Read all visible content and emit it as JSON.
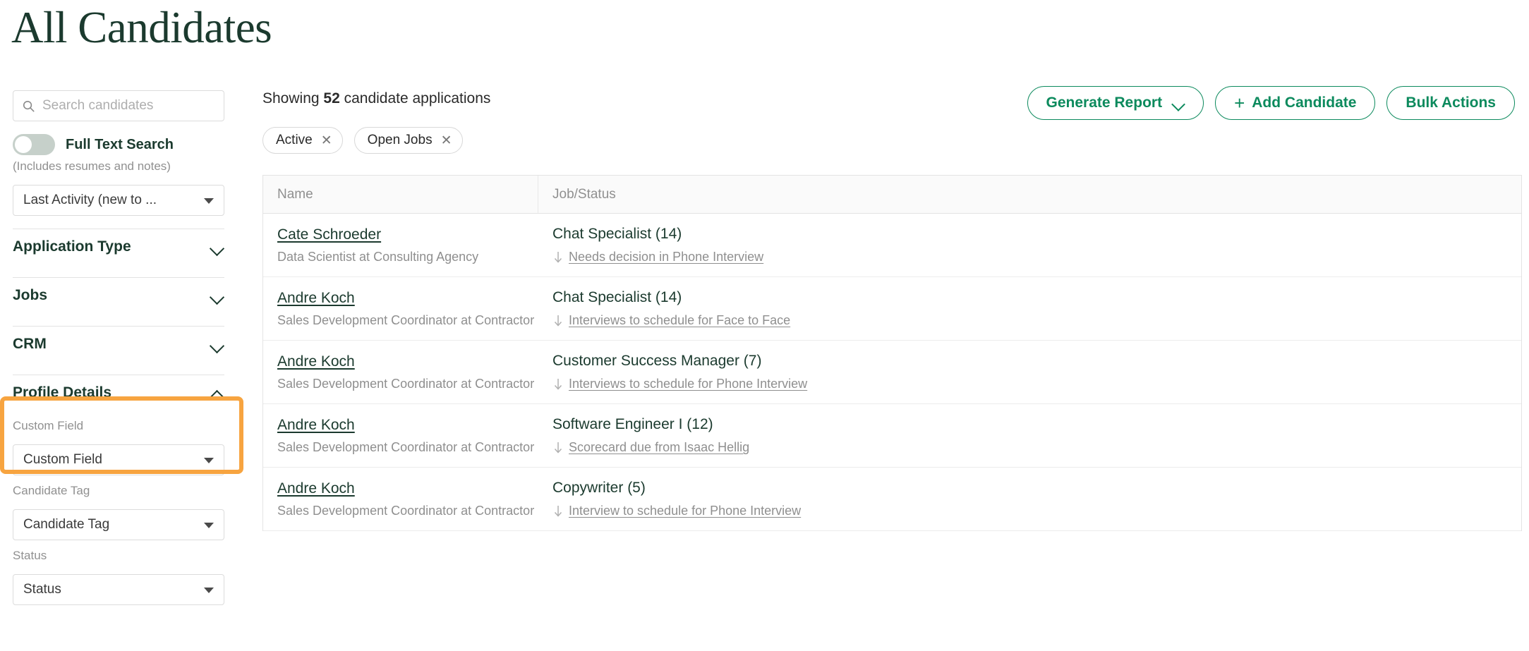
{
  "page": {
    "title": "All Candidates"
  },
  "colors": {
    "brand_green_dark": "#1b3a2e",
    "accent_green": "#0c8a5d",
    "highlight_orange": "#f7a440",
    "muted_gray": "#909090"
  },
  "sidebar": {
    "search": {
      "placeholder": "Search candidates",
      "value": "",
      "icon": "search-icon"
    },
    "full_text_search": {
      "label": "Full Text Search",
      "sublabel": "(Includes resumes and notes)",
      "state": "off"
    },
    "sort": {
      "value": "Last Activity (new to ...",
      "icon": "chevron-down-icon"
    },
    "filter_sections": [
      {
        "label": "Application Type",
        "expanded": false,
        "icon": "chevron-down-icon"
      },
      {
        "label": "Jobs",
        "expanded": false,
        "icon": "chevron-down-icon"
      },
      {
        "label": "CRM",
        "expanded": false,
        "icon": "chevron-down-icon"
      },
      {
        "label": "Profile Details",
        "expanded": true,
        "icon": "chevron-up-icon"
      }
    ],
    "profile_details_fields": [
      {
        "label": "Custom Field",
        "value": "Custom Field",
        "highlighted": false
      },
      {
        "label": "Candidate Tag",
        "value": "Candidate Tag",
        "highlighted": true
      },
      {
        "label": "Status",
        "value": "Status",
        "highlighted": false
      }
    ]
  },
  "main": {
    "showing_prefix": "Showing ",
    "showing_count": "52",
    "showing_suffix": " candidate applications",
    "chips": [
      {
        "label": "Active",
        "remove_icon": "close-icon"
      },
      {
        "label": "Open Jobs",
        "remove_icon": "close-icon"
      }
    ],
    "actions": [
      {
        "label": "Generate Report",
        "icon": "chevron-down-icon",
        "leading_icon": null
      },
      {
        "label": "Add Candidate",
        "icon": null,
        "leading_icon": "plus-icon"
      },
      {
        "label": "Bulk Actions",
        "icon": null,
        "leading_icon": null
      }
    ],
    "table": {
      "columns": [
        "Name",
        "Job/Status"
      ],
      "rows": [
        {
          "name": "Cate Schroeder",
          "subtitle": "Data Scientist at Consulting Agency",
          "job": "Chat Specialist (14)",
          "status": "Needs decision in Phone Interview",
          "status_icon": "arrow-down-icon"
        },
        {
          "name": "Andre Koch",
          "subtitle": "Sales Development Coordinator at Contractor",
          "job": "Chat Specialist (14)",
          "status": "Interviews to schedule for Face to Face",
          "status_icon": "arrow-down-icon"
        },
        {
          "name": "Andre Koch",
          "subtitle": "Sales Development Coordinator at Contractor",
          "job": "Customer Success Manager (7)",
          "status": "Interviews to schedule for Phone Interview",
          "status_icon": "arrow-down-icon"
        },
        {
          "name": "Andre Koch",
          "subtitle": "Sales Development Coordinator at Contractor",
          "job": "Software Engineer I (12)",
          "status": "Scorecard due from Isaac Hellig",
          "status_icon": "arrow-down-icon"
        },
        {
          "name": "Andre Koch",
          "subtitle": "Sales Development Coordinator at Contractor",
          "job": "Copywriter (5)",
          "status": "Interview to schedule for Phone Interview",
          "status_icon": "arrow-down-icon"
        }
      ]
    }
  }
}
